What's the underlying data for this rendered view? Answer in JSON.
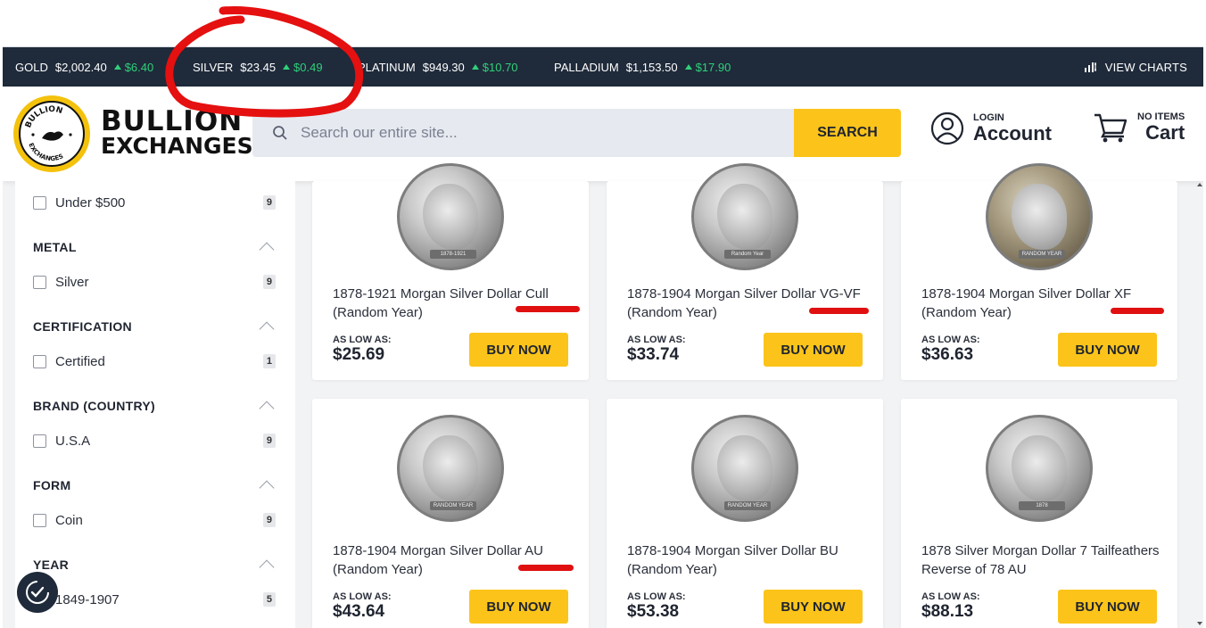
{
  "ticker": {
    "items": [
      {
        "symbol": "GOLD",
        "price": "$2,002.40",
        "change": "$6.40"
      },
      {
        "symbol": "SILVER",
        "price": "$23.45",
        "change": "$0.49"
      },
      {
        "symbol": "PLATINUM",
        "price": "$949.30",
        "change": "$10.70"
      },
      {
        "symbol": "PALLADIUM",
        "price": "$1,153.50",
        "change": "$17.90"
      }
    ],
    "view_charts": "VIEW CHARTS",
    "up_color": "#2fd07a"
  },
  "header": {
    "logo_line1": "BULLION",
    "logo_line2": "EXCHANGES",
    "badge_top": "BULLION",
    "badge_bottom": "EXCHANGES",
    "search_placeholder": "Search our entire site...",
    "search_button": "SEARCH",
    "account_small": "LOGIN",
    "account_big": "Account",
    "cart_small": "NO ITEMS",
    "cart_big": "Cart"
  },
  "filters": {
    "price_option": {
      "label": "Under $500",
      "count": "9"
    },
    "groups": [
      {
        "title": "METAL",
        "option": "Silver",
        "count": "9"
      },
      {
        "title": "CERTIFICATION",
        "option": "Certified",
        "count": "1"
      },
      {
        "title": "BRAND (COUNTRY)",
        "option": "U.S.A",
        "count": "9"
      },
      {
        "title": "FORM",
        "option": "Coin",
        "count": "9"
      },
      {
        "title": "YEAR",
        "option": "1849-1907",
        "count": "5"
      }
    ]
  },
  "products": [
    {
      "title": "1878-1921 Morgan Silver Dollar Cull (Random Year)",
      "low_label": "AS LOW AS:",
      "price": "$25.69",
      "buy": "BUY NOW",
      "coin_tag": "1878-1921"
    },
    {
      "title": "1878-1904 Morgan Silver Dollar VG-VF (Random Year)",
      "low_label": "AS LOW AS:",
      "price": "$33.74",
      "buy": "BUY NOW",
      "coin_tag": "Random Year"
    },
    {
      "title": "1878-1904 Morgan Silver Dollar XF (Random Year)",
      "low_label": "AS LOW AS:",
      "price": "$36.63",
      "buy": "BUY NOW",
      "coin_tag": "RANDOM YEAR"
    },
    {
      "title": "1878-1904 Morgan Silver Dollar AU (Random Year)",
      "low_label": "AS LOW AS:",
      "price": "$43.64",
      "buy": "BUY NOW",
      "coin_tag": "RANDOM YEAR"
    },
    {
      "title": "1878-1904 Morgan Silver Dollar BU (Random Year)",
      "low_label": "AS LOW AS:",
      "price": "$53.38",
      "buy": "BUY NOW",
      "coin_tag": "RANDOM YEAR"
    },
    {
      "title": "1878 Silver Morgan Dollar 7 Tailfeathers Reverse of 78 AU",
      "low_label": "AS LOW AS:",
      "price": "$88.13",
      "buy": "BUY NOW",
      "coin_tag": "1878"
    }
  ]
}
